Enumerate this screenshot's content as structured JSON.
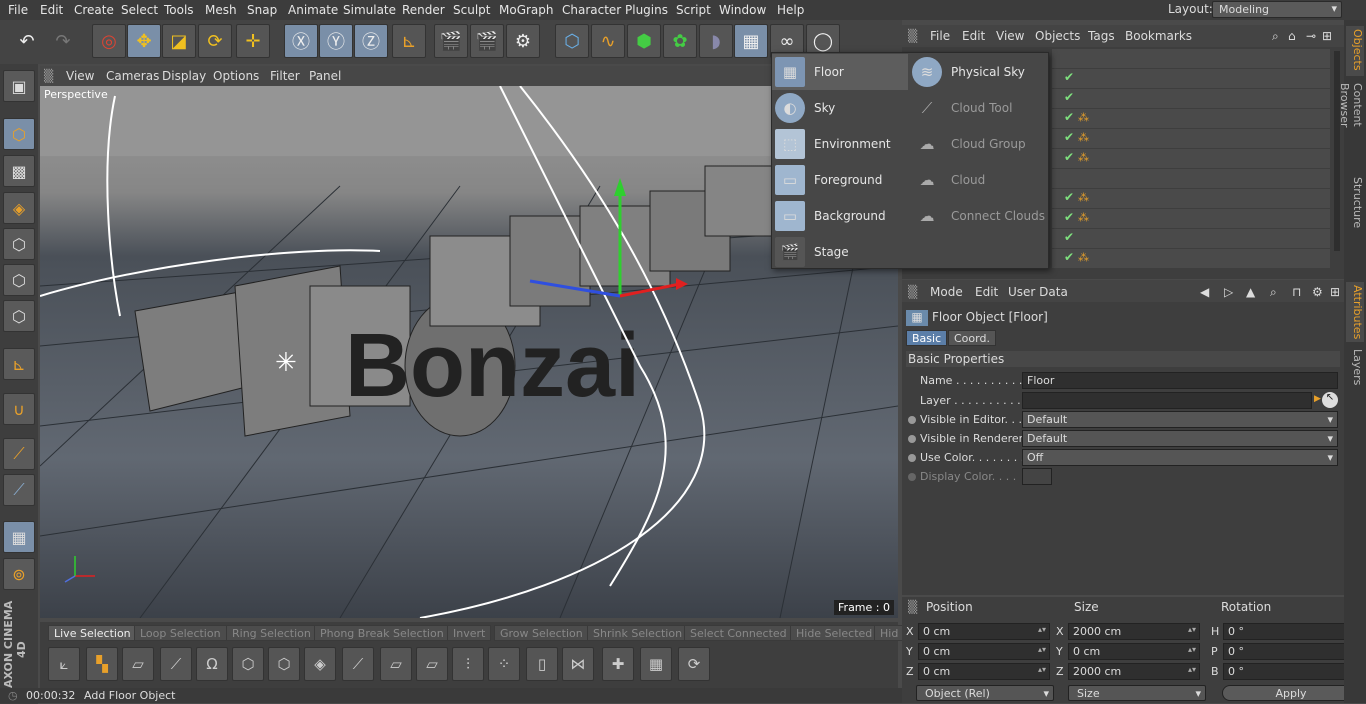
{
  "menubar": {
    "items": [
      "File",
      "Edit",
      "Create",
      "Select",
      "Tools",
      "Mesh",
      "Snap",
      "Animate",
      "Simulate",
      "Render",
      "Sculpt",
      "MoGraph",
      "Character",
      "Plugins",
      "Script",
      "Window",
      "Help"
    ],
    "layout_label": "Layout:",
    "layout_value": "Modeling"
  },
  "viewport": {
    "menu": [
      "View",
      "Cameras",
      "Display",
      "Options",
      "Filter",
      "Panel"
    ],
    "camera_label": "Perspective",
    "frame_label": "Frame : 0",
    "scene_text": "Bonzai"
  },
  "selection_bar": {
    "items": [
      "Live Selection",
      "Loop Selection",
      "Ring Selection",
      "Phong Break Selection",
      "Invert",
      "Grow Selection",
      "Shrink Selection",
      "Select Connected",
      "Hide Selected",
      "Hid"
    ]
  },
  "status": {
    "time": "00:00:32",
    "message": "Add Floor Object"
  },
  "brand": "MAXON CINEMA 4D",
  "object_manager": {
    "menu": [
      "File",
      "Edit",
      "View",
      "Objects",
      "Tags",
      "Bookmarks"
    ]
  },
  "popup": {
    "left": [
      {
        "label": "Floor",
        "icon": "floor-icon"
      },
      {
        "label": "Sky",
        "icon": "sky-icon"
      },
      {
        "label": "Environment",
        "icon": "environment-icon"
      },
      {
        "label": "Foreground",
        "icon": "foreground-icon"
      },
      {
        "label": "Background",
        "icon": "background-icon"
      },
      {
        "label": "Stage",
        "icon": "stage-icon"
      }
    ],
    "right": [
      {
        "label": "Physical Sky",
        "icon": "physical-sky-icon"
      },
      {
        "label": "Cloud Tool",
        "icon": "cloud-tool-icon"
      },
      {
        "label": "Cloud Group",
        "icon": "cloud-group-icon"
      },
      {
        "label": "Cloud",
        "icon": "cloud-icon"
      },
      {
        "label": "Connect Clouds",
        "icon": "connect-clouds-icon"
      }
    ]
  },
  "attributes": {
    "menu": [
      "Mode",
      "Edit",
      "User Data"
    ],
    "object_title": "Floor Object [Floor]",
    "tabs": [
      "Basic",
      "Coord."
    ],
    "section": "Basic Properties",
    "name_label": "Name . . . . . . . . . . . .",
    "name_value": "Floor",
    "layer_label": "Layer . . . . . . . . . . . .",
    "layer_value": "",
    "editor_label": "Visible in Editor. . .",
    "editor_value": "Default",
    "renderer_label": "Visible in Renderer",
    "renderer_value": "Default",
    "usecolor_label": "Use Color. . . . . . . .",
    "usecolor_value": "Off",
    "displaycolor_label": "Display Color. . . ."
  },
  "coordinates": {
    "headers": [
      "Position",
      "Size",
      "Rotation"
    ],
    "position": [
      {
        "axis": "X",
        "value": "0 cm"
      },
      {
        "axis": "Y",
        "value": "0 cm"
      },
      {
        "axis": "Z",
        "value": "0 cm"
      }
    ],
    "size": [
      {
        "axis": "X",
        "value": "2000 cm"
      },
      {
        "axis": "Y",
        "value": "0 cm"
      },
      {
        "axis": "Z",
        "value": "2000 cm"
      }
    ],
    "rotation": [
      {
        "axis": "H",
        "value": "0 °"
      },
      {
        "axis": "P",
        "value": "0 °"
      },
      {
        "axis": "B",
        "value": "0 °"
      }
    ],
    "mode_select": "Object (Rel)",
    "size_select": "Size",
    "apply_label": "Apply"
  },
  "right_tabs": [
    "Objects",
    "Content Browser",
    "Structure",
    "Attributes",
    "Layers"
  ],
  "colors": {
    "accent": "#e8a02a",
    "selection": "#5b7ea8",
    "check": "#7ee07e"
  }
}
